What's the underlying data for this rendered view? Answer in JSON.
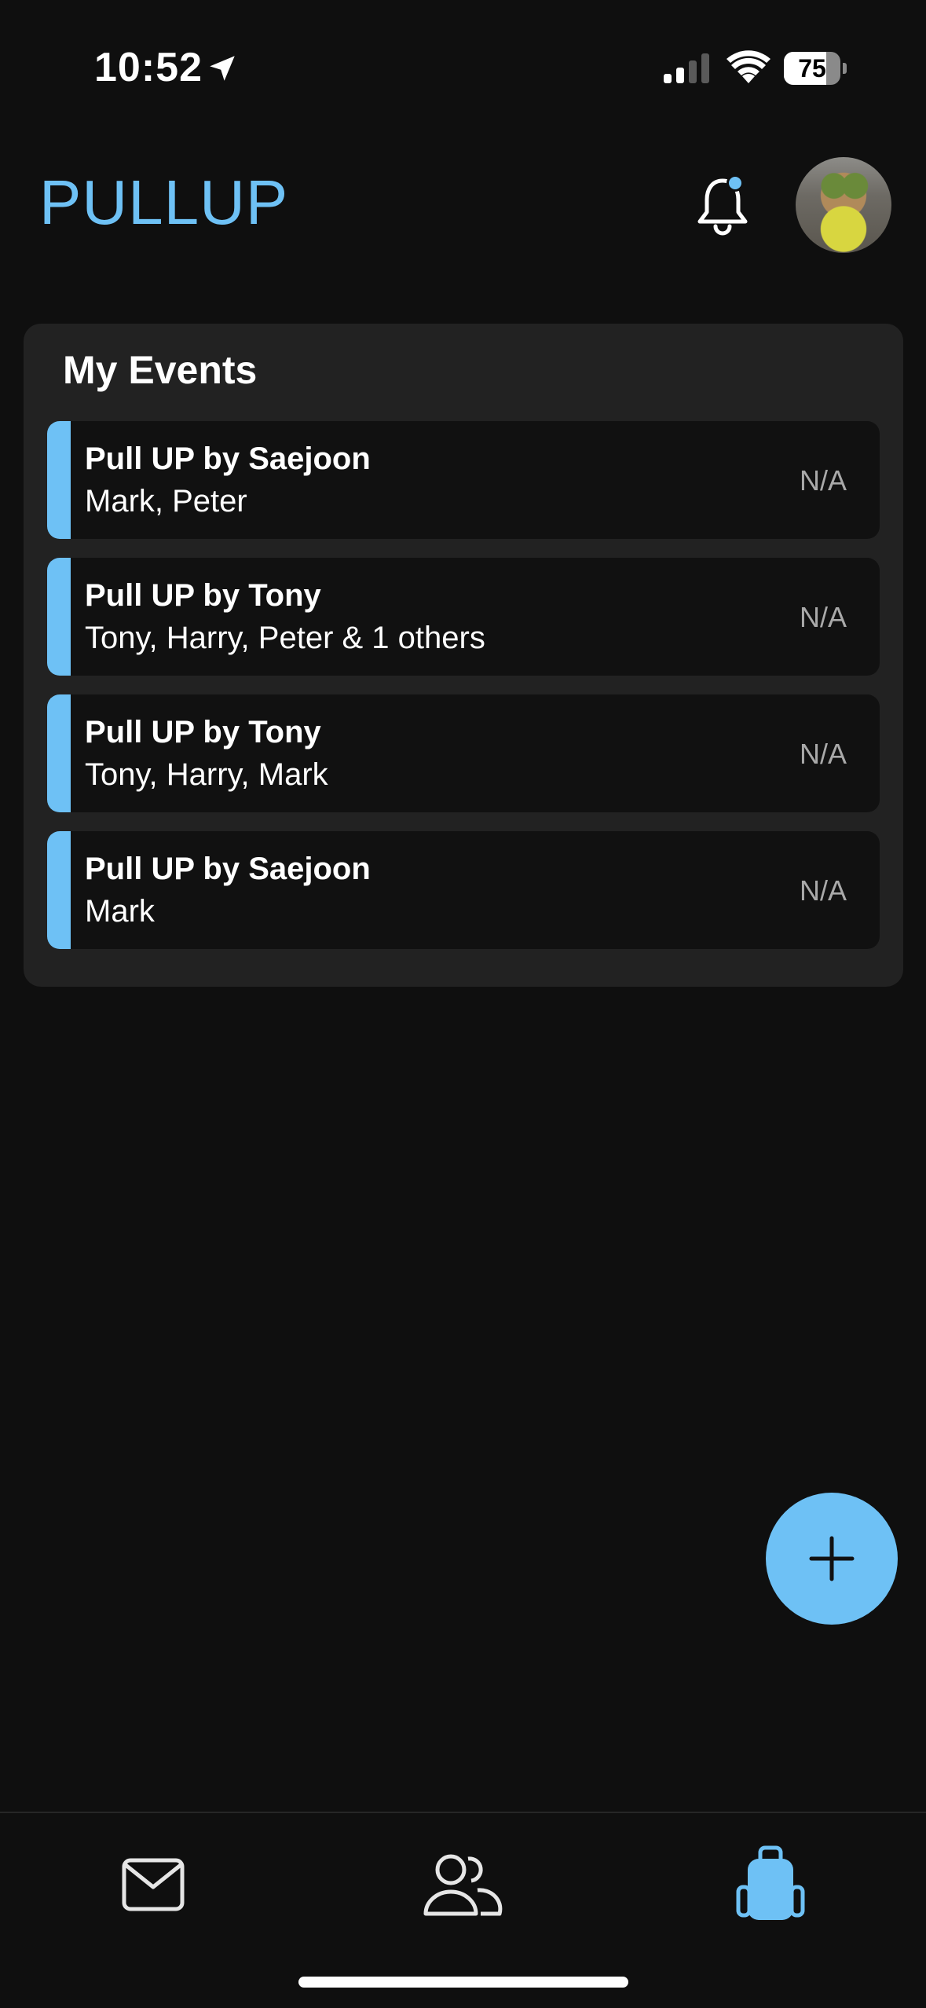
{
  "status_bar": {
    "time": "10:52",
    "battery": "75",
    "battery_level": 0.75
  },
  "header": {
    "title": "PULLUP",
    "notification_dot": true,
    "accent_color": "#6ec1f5"
  },
  "events": {
    "title": "My Events",
    "items": [
      {
        "name": "Pull UP by Saejoon",
        "people": "Mark, Peter",
        "status": "N/A"
      },
      {
        "name": "Pull UP by Tony",
        "people": "Tony, Harry, Peter & 1 others",
        "status": "N/A"
      },
      {
        "name": "Pull UP by Tony",
        "people": "Tony, Harry, Mark",
        "status": "N/A"
      },
      {
        "name": "Pull UP by Saejoon",
        "people": "Mark",
        "status": "N/A"
      }
    ]
  },
  "fab": {
    "icon": "plus-icon"
  },
  "tab_bar": {
    "tabs": [
      {
        "icon": "mail-icon",
        "active": false
      },
      {
        "icon": "people-icon",
        "active": false
      },
      {
        "icon": "backpack-icon",
        "active": true
      }
    ]
  }
}
